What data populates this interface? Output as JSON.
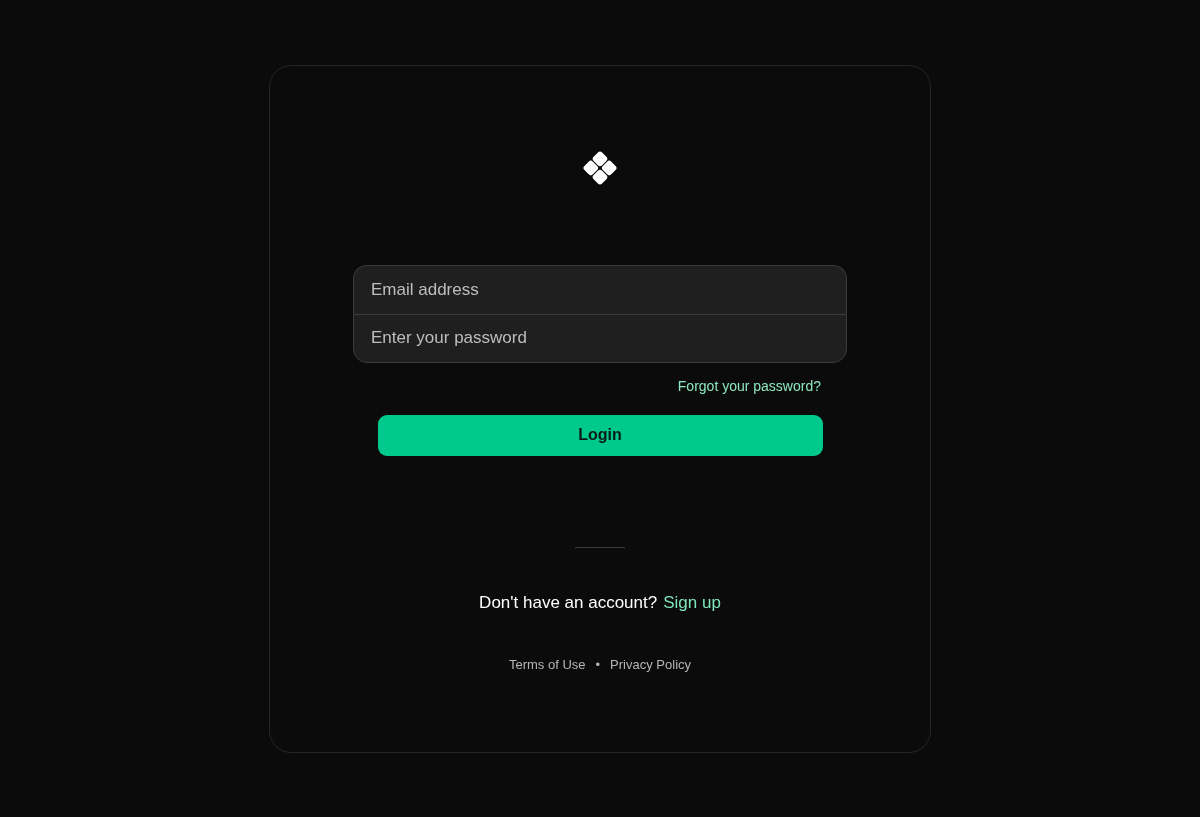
{
  "login_form": {
    "fields": [
      {
        "placeholder": "Email address"
      },
      {
        "placeholder": "Enter your password"
      }
    ],
    "forgot_link": "Forgot your password?",
    "login_button": "Login"
  },
  "signup": {
    "prompt": "Don't have an account?",
    "link": "Sign up"
  },
  "footer": {
    "links": [
      "Terms of Use",
      "Privacy Policy"
    ],
    "separator": "•"
  }
}
